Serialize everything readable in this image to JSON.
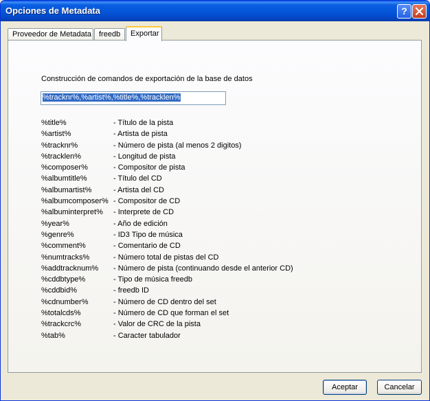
{
  "window": {
    "title": "Opciones de Metadata",
    "help": "?"
  },
  "tabs": [
    {
      "label": "Proveedor de Metadata",
      "active": false
    },
    {
      "label": "freedb",
      "active": false
    },
    {
      "label": "Exportar",
      "active": true
    }
  ],
  "export": {
    "heading": "Construcción de comandos de exportación de la base de datos",
    "command_value": "%tracknr%,%artist%,%title%,%tracklen%",
    "variables": [
      {
        "var": "%title%",
        "desc": "- Título de la pista"
      },
      {
        "var": "%artist%",
        "desc": "- Artista de pista"
      },
      {
        "var": "%tracknr%",
        "desc": "- Número de pista (al menos 2 digitos)"
      },
      {
        "var": "%tracklen%",
        "desc": "- Longitud de pista"
      },
      {
        "var": "%composer%",
        "desc": "- Compositor de pista"
      },
      {
        "var": "%albumtitle%",
        "desc": "- Título del CD"
      },
      {
        "var": "%albumartist%",
        "desc": "- Artista del CD"
      },
      {
        "var": "%albumcomposer%",
        "desc": "- Compositor de CD"
      },
      {
        "var": "%albuminterpret%",
        "desc": "- Interprete de CD"
      },
      {
        "var": "%year%",
        "desc": "- Año de edición"
      },
      {
        "var": "%genre%",
        "desc": "- ID3 Tipo de música"
      },
      {
        "var": "%comment%",
        "desc": "- Comentario de CD"
      },
      {
        "var": "%numtracks%",
        "desc": "- Número total de pistas del CD"
      },
      {
        "var": "%addtracknum%",
        "desc": "- Número de pista (continuando desde el anterior CD)"
      },
      {
        "var": "%cddbtype%",
        "desc": "- Tipo de música freedb"
      },
      {
        "var": "%cddbid%",
        "desc": "- freedb ID"
      },
      {
        "var": "%cdnumber%",
        "desc": "- Número de CD dentro del set"
      },
      {
        "var": "%totalcds%",
        "desc": "- Número de CD que forman el set"
      },
      {
        "var": "%trackcrc%",
        "desc": "- Valor de CRC de la pista"
      },
      {
        "var": "%tab%",
        "desc": "- Caracter tabulador"
      }
    ]
  },
  "buttons": {
    "ok": "Aceptar",
    "cancel": "Cancelar"
  }
}
